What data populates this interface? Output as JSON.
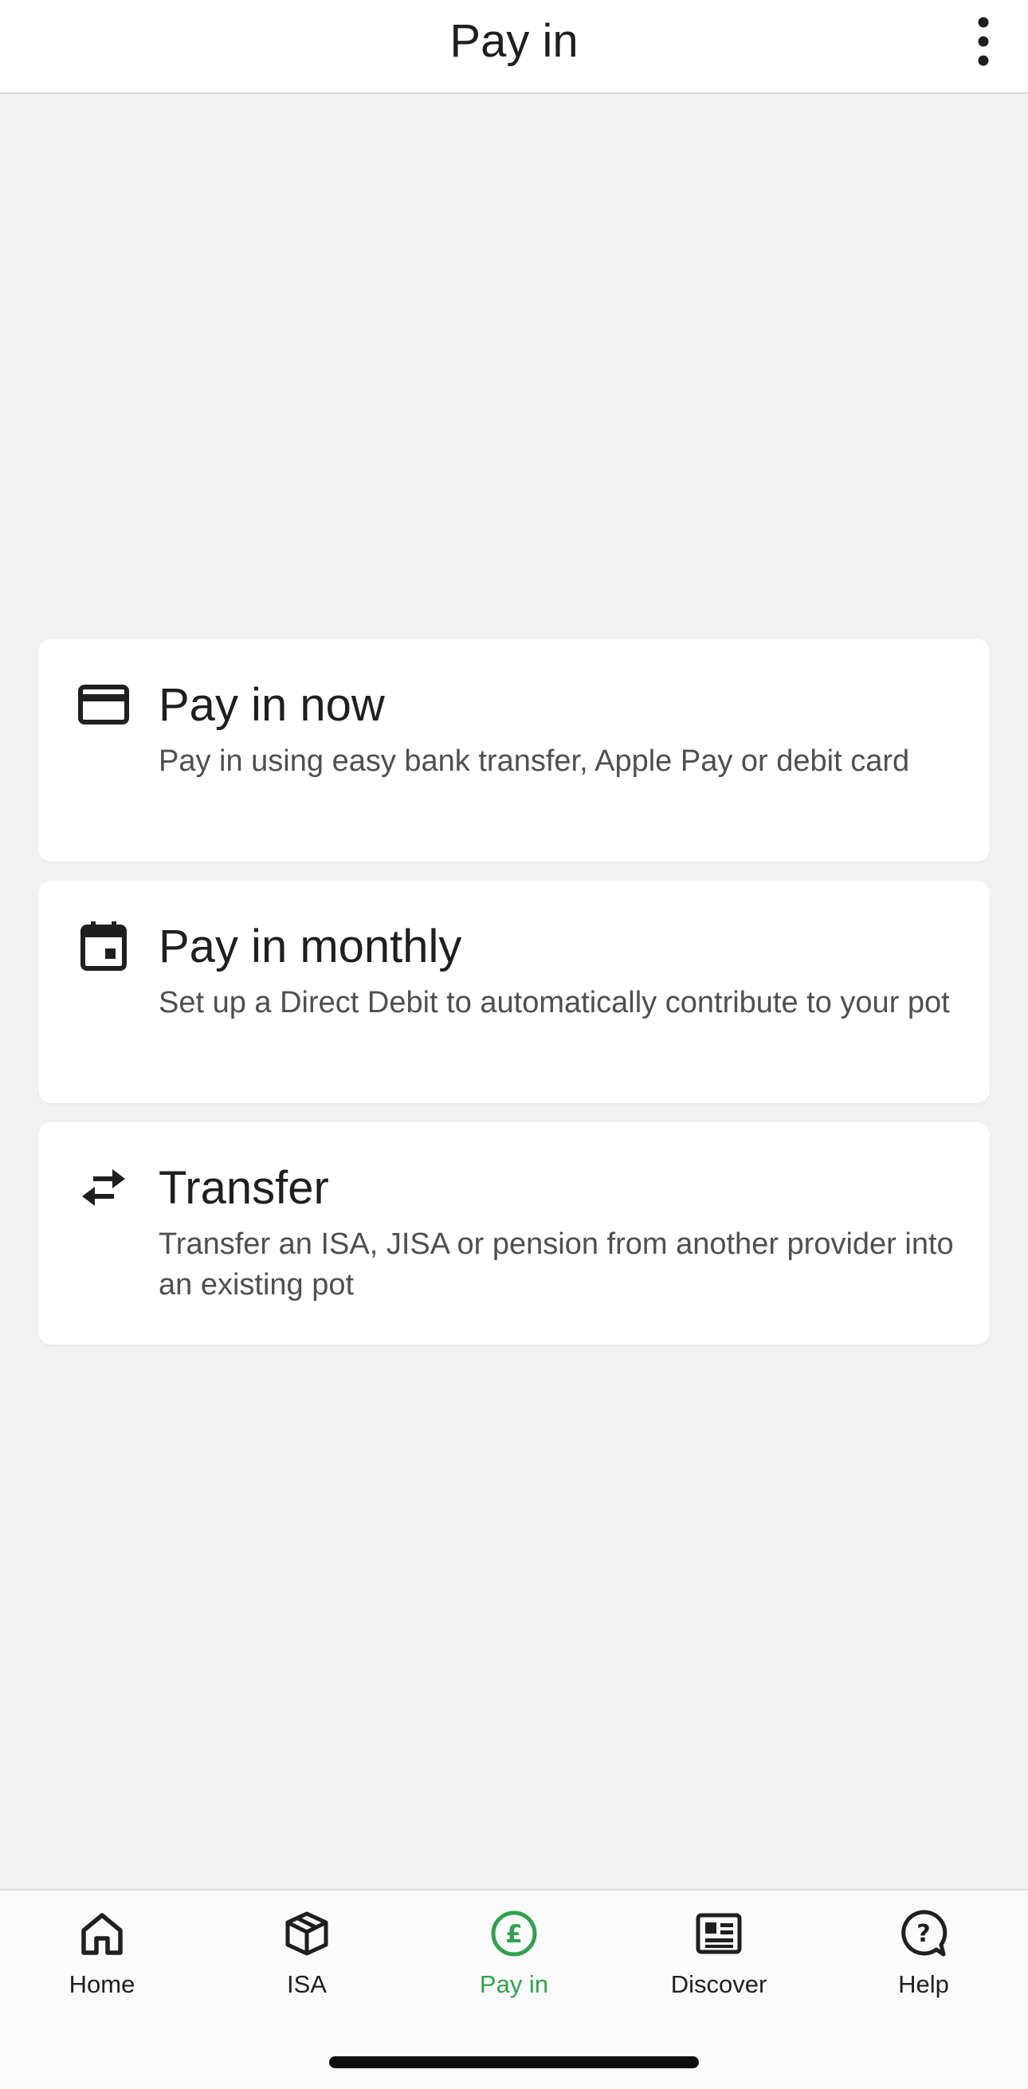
{
  "header": {
    "title": "Pay in",
    "menu_icon": "more-vertical-icon"
  },
  "options": [
    {
      "icon": "credit-card-icon",
      "title": "Pay in now",
      "description": "Pay in using easy bank transfer, Apple Pay or debit card"
    },
    {
      "icon": "calendar-icon",
      "title": "Pay in monthly",
      "description": "Set up a Direct Debit to automatically contribute to your pot"
    },
    {
      "icon": "transfer-arrows-icon",
      "title": "Transfer",
      "description": "Transfer an ISA, JISA or pension from another provider into an existing pot"
    }
  ],
  "nav": {
    "items": [
      {
        "label": "Home",
        "icon": "home-icon",
        "active": false
      },
      {
        "label": "ISA",
        "icon": "box-icon",
        "active": false
      },
      {
        "label": "Pay in",
        "icon": "pound-circle-icon",
        "active": true
      },
      {
        "label": "Discover",
        "icon": "newspaper-icon",
        "active": false
      },
      {
        "label": "Help",
        "icon": "help-bubble-icon",
        "active": false
      }
    ]
  },
  "colors": {
    "background": "#f1f1f1",
    "card": "#ffffff",
    "accent_green": "#2fa24e",
    "text_primary": "#1f1f1f",
    "text_secondary": "#4f4f4f"
  }
}
